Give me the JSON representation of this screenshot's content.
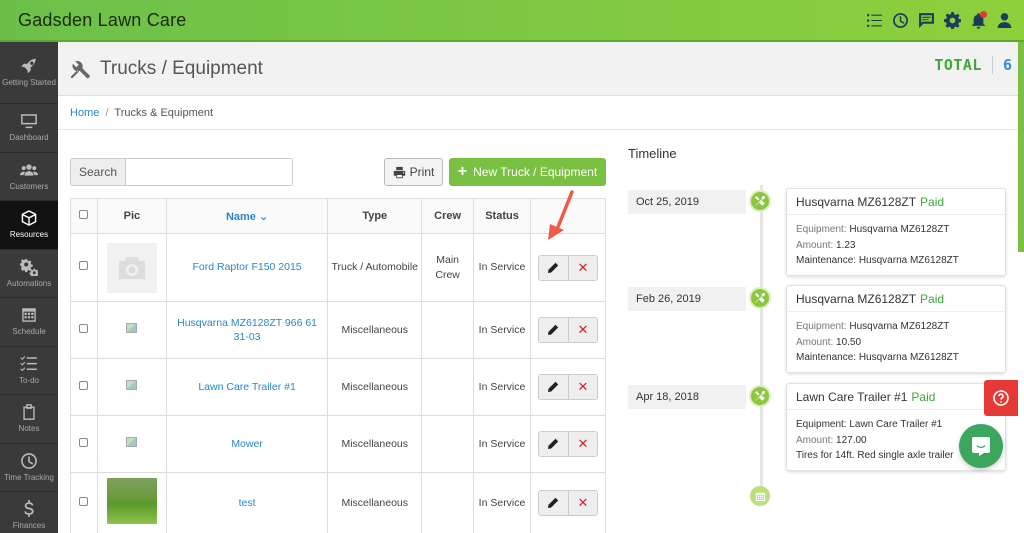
{
  "app": {
    "title": "Gadsden Lawn Care"
  },
  "topbar": {
    "icons": [
      "tasks-icon",
      "clock-icon",
      "chat-icon",
      "gear-icon",
      "bell-icon",
      "user-icon"
    ]
  },
  "sidebar": {
    "items": [
      {
        "label": "Getting Started",
        "icon": "rocket-icon"
      },
      {
        "label": "Dashboard",
        "icon": "monitor-icon"
      },
      {
        "label": "Customers",
        "icon": "users-icon"
      },
      {
        "label": "Resources",
        "icon": "cube-icon",
        "active": true
      },
      {
        "label": "Automations",
        "icon": "gears-icon"
      },
      {
        "label": "Schedule",
        "icon": "calendar-icon"
      },
      {
        "label": "To-do",
        "icon": "list-icon"
      },
      {
        "label": "Notes",
        "icon": "clipboard-icon"
      },
      {
        "label": "Time Tracking",
        "icon": "clock-icon"
      },
      {
        "label": "Finances",
        "icon": "dollar-icon"
      }
    ]
  },
  "header": {
    "title": "Trucks / Equipment",
    "total_label": "TOTAL",
    "total_value": "6"
  },
  "breadcrumb": {
    "home": "Home",
    "sep": "/",
    "current": "Trucks & Equipment"
  },
  "controls": {
    "search_label": "Search",
    "search_placeholder": "",
    "print_label": "Print",
    "new_label": "New Truck / Equipment"
  },
  "table": {
    "headers": {
      "pic": "Pic",
      "name": "Name",
      "type": "Type",
      "crew": "Crew",
      "status": "Status"
    },
    "rows": [
      {
        "pic": "placeholder",
        "name": "Ford Raptor F150 2015",
        "type": "Truck / Automobile",
        "crew": "Main Crew",
        "status": "In Service"
      },
      {
        "pic": "broken",
        "name": "Husqvarna MZ6128ZT 966 61 31-03",
        "type": "Miscellaneous",
        "crew": "",
        "status": "In Service"
      },
      {
        "pic": "broken",
        "name": "Lawn Care Trailer #1",
        "type": "Miscellaneous",
        "crew": "",
        "status": "In Service"
      },
      {
        "pic": "broken",
        "name": "Mower",
        "type": "Miscellaneous",
        "crew": "",
        "status": "In Service"
      },
      {
        "pic": "photo",
        "name": "test",
        "type": "Miscellaneous",
        "crew": "",
        "status": "In Service"
      }
    ]
  },
  "timeline": {
    "title": "Timeline",
    "entries": [
      {
        "date": "Oct 25, 2019",
        "title": "Husqvarna MZ6128ZT",
        "status": "Paid",
        "lines": [
          [
            "Equipment:",
            "Husqvarna MZ6128ZT"
          ],
          [
            "Amount:",
            "1.23"
          ],
          [
            "Maintenance:",
            "Husqvarna MZ6128ZT"
          ]
        ]
      },
      {
        "date": "Feb 26, 2019",
        "title": "Husqvarna MZ6128ZT",
        "status": "Paid",
        "lines": [
          [
            "Equipment:",
            "Husqvarna MZ6128ZT"
          ],
          [
            "Amount:",
            "10.50"
          ],
          [
            "Maintenance:",
            "Husqvarna MZ6128ZT"
          ]
        ]
      },
      {
        "date": "Apr 18, 2018",
        "title": "Lawn Care Trailer #1",
        "status": "Paid",
        "lines": [
          [
            "Equipment:",
            "Lawn Care Trailer #1"
          ],
          [
            "Amount:",
            "127.00"
          ],
          [
            "",
            "Tires for 14ft. Red single axle trailer"
          ]
        ]
      }
    ]
  },
  "colors": {
    "brand_green": "#7ac143",
    "link_blue": "#2a85c7",
    "paid_green": "#3ea83a",
    "danger_red": "#e02020",
    "sidebar_bg": "#3a3a3a"
  }
}
